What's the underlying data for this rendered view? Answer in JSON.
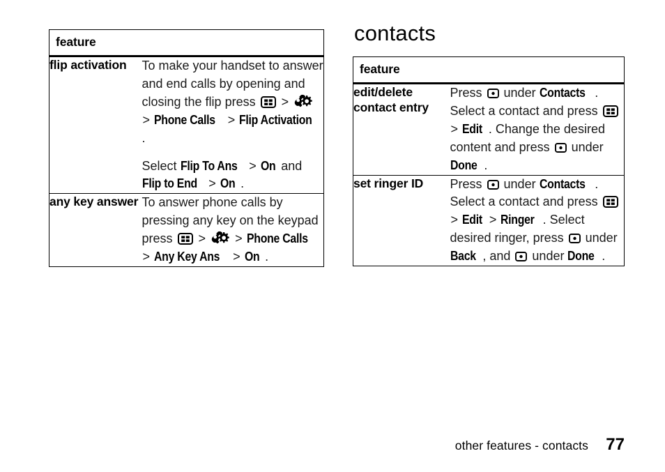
{
  "document": {
    "type": "phone-user-guide-page",
    "background": "#ffffff",
    "text_color": "#000000"
  },
  "left_column": {
    "table": {
      "header": "feature",
      "rows": [
        {
          "label": "flip activation",
          "paragraphs": [
            {
              "parts": [
                {
                  "t": "text",
                  "v": "To make your handset to answer and end calls by opening and closing the flip press "
                },
                {
                  "t": "icon",
                  "v": "menu-grid-icon"
                },
                {
                  "t": "gt",
                  "v": ">"
                },
                {
                  "t": "icon",
                  "v": "settings-wrench-gear-icon"
                },
                {
                  "t": "gt",
                  "v": ">"
                },
                {
                  "t": "menu",
                  "v": "Phone Calls"
                },
                {
                  "t": "gt",
                  "v": ">"
                },
                {
                  "t": "menu",
                  "v": "Flip Activation"
                },
                {
                  "t": "text",
                  "v": "."
                }
              ]
            },
            {
              "parts": [
                {
                  "t": "text",
                  "v": "Select "
                },
                {
                  "t": "menu",
                  "v": "Flip To Ans"
                },
                {
                  "t": "gt",
                  "v": ">"
                },
                {
                  "t": "menu",
                  "v": "On"
                },
                {
                  "t": "text",
                  "v": " and "
                },
                {
                  "t": "menu",
                  "v": "Flip to End"
                },
                {
                  "t": "gt",
                  "v": ">"
                },
                {
                  "t": "menu",
                  "v": "On"
                },
                {
                  "t": "text",
                  "v": "."
                }
              ]
            }
          ]
        },
        {
          "label": "any key answer",
          "paragraphs": [
            {
              "parts": [
                {
                  "t": "text",
                  "v": "To answer phone calls by pressing any key on the keypad press "
                },
                {
                  "t": "icon",
                  "v": "menu-grid-icon"
                },
                {
                  "t": "gt",
                  "v": ">"
                },
                {
                  "t": "icon",
                  "v": "settings-wrench-gear-icon"
                },
                {
                  "t": "gt",
                  "v": ">"
                },
                {
                  "t": "menu",
                  "v": "Phone Calls"
                },
                {
                  "t": "gt",
                  "v": ">"
                },
                {
                  "t": "menu",
                  "v": "Any Key Ans"
                },
                {
                  "t": "gt",
                  "v": ">"
                },
                {
                  "t": "menu",
                  "v": "On"
                },
                {
                  "t": "text",
                  "v": "."
                }
              ]
            }
          ]
        }
      ]
    }
  },
  "right_column": {
    "heading": "contacts",
    "table": {
      "header": "feature",
      "rows": [
        {
          "label": "edit/delete contact entry",
          "paragraphs": [
            {
              "parts": [
                {
                  "t": "text",
                  "v": "Press "
                },
                {
                  "t": "icon",
                  "v": "softkey-icon"
                },
                {
                  "t": "text",
                  "v": " under "
                },
                {
                  "t": "menu",
                  "v": "Contacts"
                },
                {
                  "t": "text",
                  "v": ". Select a contact and press "
                },
                {
                  "t": "icon",
                  "v": "menu-grid-icon"
                },
                {
                  "t": "gt",
                  "v": ">"
                },
                {
                  "t": "menu",
                  "v": "Edit"
                },
                {
                  "t": "text",
                  "v": ". Change the desired content and press "
                },
                {
                  "t": "icon",
                  "v": "softkey-icon"
                },
                {
                  "t": "text",
                  "v": " under "
                },
                {
                  "t": "menu",
                  "v": "Done"
                },
                {
                  "t": "text",
                  "v": "."
                }
              ]
            }
          ]
        },
        {
          "label": "set ringer ID",
          "paragraphs": [
            {
              "parts": [
                {
                  "t": "text",
                  "v": "Press "
                },
                {
                  "t": "icon",
                  "v": "softkey-icon"
                },
                {
                  "t": "text",
                  "v": " under "
                },
                {
                  "t": "menu",
                  "v": "Contacts"
                },
                {
                  "t": "text",
                  "v": ". Select a contact and press "
                },
                {
                  "t": "icon",
                  "v": "menu-grid-icon"
                },
                {
                  "t": "gt",
                  "v": ">"
                },
                {
                  "t": "menu",
                  "v": "Edit"
                },
                {
                  "t": "gt",
                  "v": ">"
                },
                {
                  "t": "menu",
                  "v": "Ringer"
                },
                {
                  "t": "text",
                  "v": ". Select desired ringer, press "
                },
                {
                  "t": "icon",
                  "v": "softkey-icon"
                },
                {
                  "t": "text",
                  "v": " under "
                },
                {
                  "t": "menu",
                  "v": "Back"
                },
                {
                  "t": "text",
                  "v": ", and "
                },
                {
                  "t": "icon",
                  "v": "softkey-icon"
                },
                {
                  "t": "text",
                  "v": " under "
                },
                {
                  "t": "menu",
                  "v": "Done"
                },
                {
                  "t": "text",
                  "v": "."
                }
              ]
            }
          ]
        }
      ]
    }
  },
  "footer": {
    "breadcrumb": "other features - contacts",
    "page_number": "77"
  },
  "icons": {
    "menu-grid-icon": "rounded rectangle containing four small squares (main menu key)",
    "settings-wrench-gear-icon": "wrench overlapping a gear (settings)",
    "softkey-icon": "rounded rectangle containing a centered dot (soft key)"
  }
}
